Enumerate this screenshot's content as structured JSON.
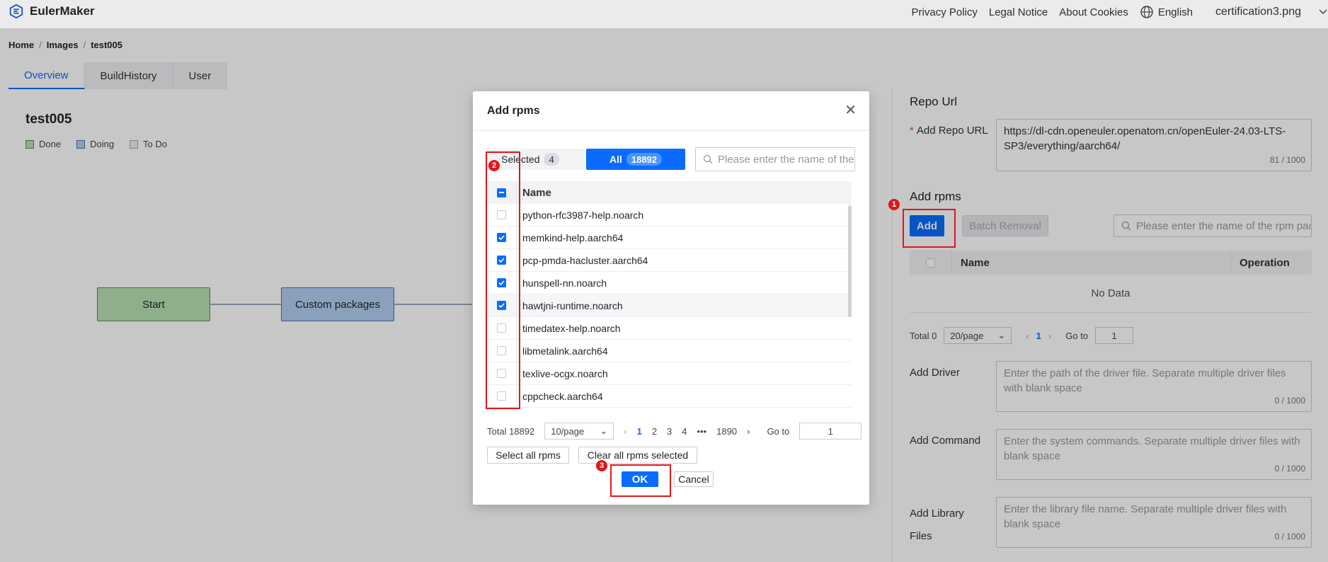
{
  "topbar": {
    "app_name": "EulerMaker",
    "links": [
      "Privacy Policy",
      "Legal Notice",
      "About Cookies"
    ],
    "language": "English",
    "user": "certification3.png"
  },
  "breadcrumb": [
    "Home",
    "Images",
    "test005"
  ],
  "tabs": [
    "Overview",
    "BuildHistory",
    "User"
  ],
  "project": {
    "title": "test005",
    "legend": [
      {
        "label": "Done",
        "color": "#b7e0b0"
      },
      {
        "label": "Doing",
        "color": "#b3cdf0"
      },
      {
        "label": "To Do",
        "color": "#eeeeee"
      }
    ],
    "flow": [
      "Start",
      "Custom packages"
    ]
  },
  "right_panel": {
    "repo_url_title": "Repo Url",
    "add_repo_url_label": "Add Repo URL",
    "repo_url_value": "https://dl-cdn.openeuler.openatom.cn/openEuler-24.03-LTS-SP3/everything/aarch64/",
    "repo_url_counter": "81 / 1000",
    "add_rpms_title": "Add rpms",
    "add_button": "Add",
    "batch_removal_button": "Batch Removal",
    "search_placeholder": "Please enter the name of the rpm pac",
    "table_headers": [
      "Name",
      "Operation"
    ],
    "no_data": "No Data",
    "pager": {
      "total": "Total 0",
      "per_page": "20/page",
      "page": "1",
      "goto_label": "Go to",
      "goto_value": "1"
    },
    "driver_label": "Add Driver",
    "driver_placeholder": "Enter the path of the driver file. Separate multiple driver files with blank space",
    "driver_counter": "0 / 1000",
    "command_label": "Add Command",
    "command_placeholder": "Enter the system commands. Separate multiple driver files with blank space",
    "command_counter": "0 / 1000",
    "library_label_1": "Add Library",
    "library_label_2": "Files",
    "library_placeholder": "Enter the library file name. Separate multiple driver files with blank space",
    "library_counter": "0 / 1000"
  },
  "modal": {
    "title": "Add rpms",
    "selected_label": "Selected",
    "selected_count": "4",
    "all_label": "All",
    "all_count": "18892",
    "search_placeholder": "Please enter the name of the",
    "column": "Name",
    "rows": [
      {
        "name": "python-rfc3987-help.noarch",
        "checked": false
      },
      {
        "name": "memkind-help.aarch64",
        "checked": true
      },
      {
        "name": "pcp-pmda-hacluster.aarch64",
        "checked": true
      },
      {
        "name": "hunspell-nn.noarch",
        "checked": true
      },
      {
        "name": "hawtjni-runtime.noarch",
        "checked": true
      },
      {
        "name": "timedatex-help.noarch",
        "checked": false
      },
      {
        "name": "libmetalink.aarch64",
        "checked": false
      },
      {
        "name": "texlive-ocgx.noarch",
        "checked": false
      },
      {
        "name": "cppcheck.aarch64",
        "checked": false
      }
    ],
    "pager": {
      "total": "Total 18892",
      "per_page": "10/page",
      "pages": [
        "1",
        "2",
        "3",
        "4",
        "•••",
        "1890"
      ],
      "goto_label": "Go to",
      "goto_value": "1"
    },
    "select_all": "Select all rpms",
    "clear_all": "Clear all rpms selected",
    "ok": "OK",
    "cancel": "Cancel"
  },
  "annotations": [
    "1",
    "2",
    "3"
  ]
}
